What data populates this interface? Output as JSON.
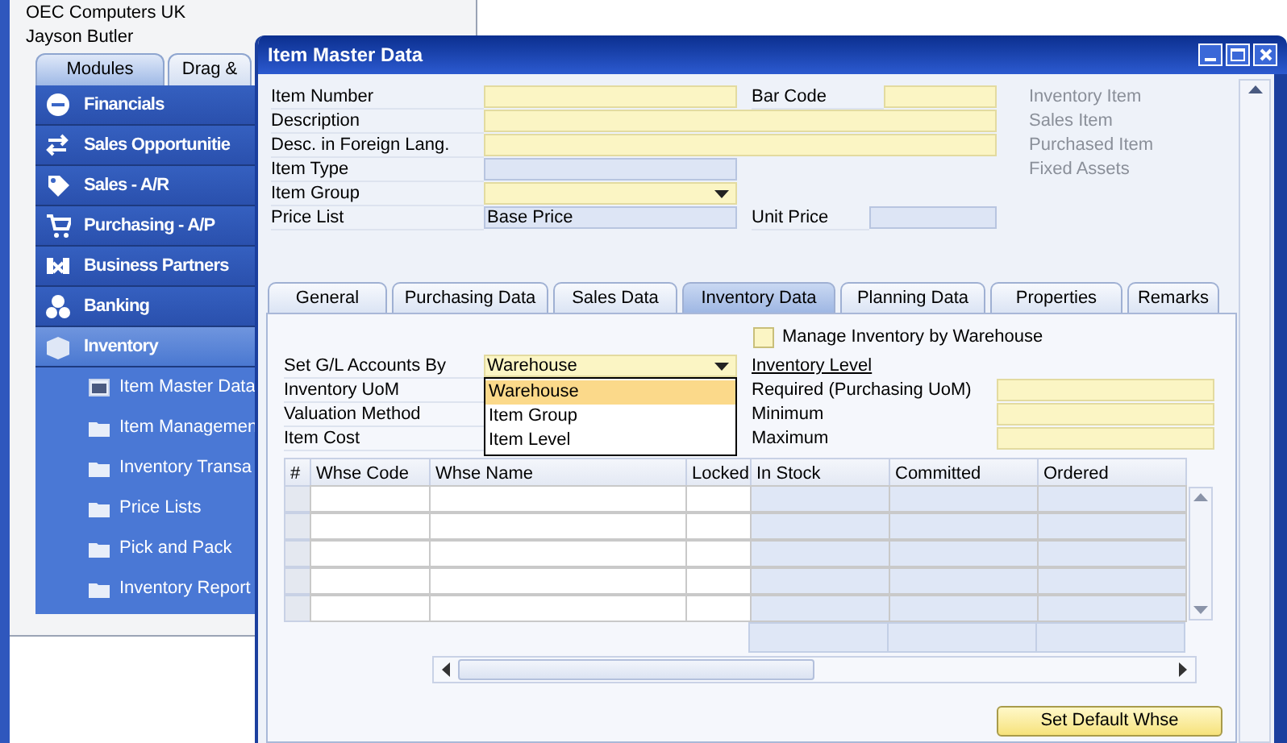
{
  "main_window": {
    "company": "OEC Computers UK",
    "user": "Jayson Butler",
    "tabs": [
      {
        "label": "Modules",
        "selected": true
      },
      {
        "label": "Drag &",
        "selected": false
      }
    ],
    "modules": [
      {
        "label": "Financials",
        "kind": "financials",
        "selected": false
      },
      {
        "label": "Sales Opportunitie",
        "kind": "opportunities",
        "selected": false
      },
      {
        "label": "Sales - A/R",
        "kind": "sales",
        "selected": false
      },
      {
        "label": "Purchasing - A/P",
        "kind": "purchasing",
        "selected": false
      },
      {
        "label": "Business Partners",
        "kind": "partners",
        "selected": false
      },
      {
        "label": "Banking",
        "kind": "banking",
        "selected": false
      },
      {
        "label": "Inventory",
        "kind": "inventory",
        "selected": true
      }
    ],
    "submenu": [
      {
        "label": "Item Master Data",
        "kind": "form"
      },
      {
        "label": "Item Managemen",
        "kind": "folder"
      },
      {
        "label": "Inventory Transa",
        "kind": "folder"
      },
      {
        "label": "Price Lists",
        "kind": "folder"
      },
      {
        "label": "Pick and Pack",
        "kind": "folder"
      },
      {
        "label": "Inventory Report",
        "kind": "folder"
      }
    ]
  },
  "dialog": {
    "title": "Item Master Data",
    "item_number": {
      "label": "Item Number",
      "kind": "input"
    },
    "bar_code": {
      "label": "Bar Code",
      "kind": "input"
    },
    "description": {
      "label": "Description",
      "kind": "input"
    },
    "foreign_description": {
      "label": "Desc. in Foreign Lang.",
      "kind": "input"
    },
    "item_type": {
      "label": "Item Type",
      "kind": "readonly"
    },
    "item_group": {
      "label": "Item Group",
      "kind": "dropdown"
    },
    "price_list": {
      "label": "Price List",
      "kind": "readonly",
      "value": "Base Price"
    },
    "unit_price": {
      "label": "Unit Price",
      "kind": "readonly"
    },
    "item_flags": [
      {
        "label": "Inventory Item",
        "disabled": true
      },
      {
        "label": "Sales Item",
        "disabled": true
      },
      {
        "label": "Purchased Item",
        "disabled": true
      },
      {
        "label": "Fixed Assets",
        "disabled": true
      }
    ],
    "tabs": [
      {
        "label": "General",
        "selected": false
      },
      {
        "label": "Purchasing Data",
        "selected": false
      },
      {
        "label": "Sales Data",
        "selected": false
      },
      {
        "label": "Inventory Data",
        "selected": true
      },
      {
        "label": "Planning Data",
        "selected": false
      },
      {
        "label": "Properties",
        "selected": false
      },
      {
        "label": "Remarks",
        "selected": false
      }
    ],
    "manage_by_warehouse": {
      "label": "Manage Inventory by Warehouse",
      "checked": false
    },
    "gl_accounts_by": {
      "label": "Set G/L Accounts By",
      "value": "Warehouse",
      "expanded": true,
      "options": [
        {
          "label": "Warehouse",
          "selected": true
        },
        {
          "label": "Item Group",
          "selected": false
        },
        {
          "label": "Item Level",
          "selected": false
        }
      ]
    },
    "left_labels": [
      "Inventory UoM",
      "Valuation Method",
      "Item Cost"
    ],
    "inventory_level": {
      "title": "Inventory Level",
      "fields": [
        {
          "label": "Required (Purchasing UoM)",
          "kind": "input"
        },
        {
          "label": "Minimum",
          "kind": "input"
        },
        {
          "label": "Maximum",
          "kind": "input"
        }
      ]
    },
    "warehouse_table": {
      "columns": [
        {
          "label": "#",
          "editable": true
        },
        {
          "label": "Whse Code",
          "editable": true
        },
        {
          "label": "Whse Name",
          "editable": true
        },
        {
          "label": "Locked",
          "editable": true
        },
        {
          "label": "In Stock",
          "editable": false
        },
        {
          "label": "Committed",
          "editable": false
        },
        {
          "label": "Ordered",
          "editable": false
        }
      ]
    },
    "set_default_button": "Set Default Whse"
  }
}
